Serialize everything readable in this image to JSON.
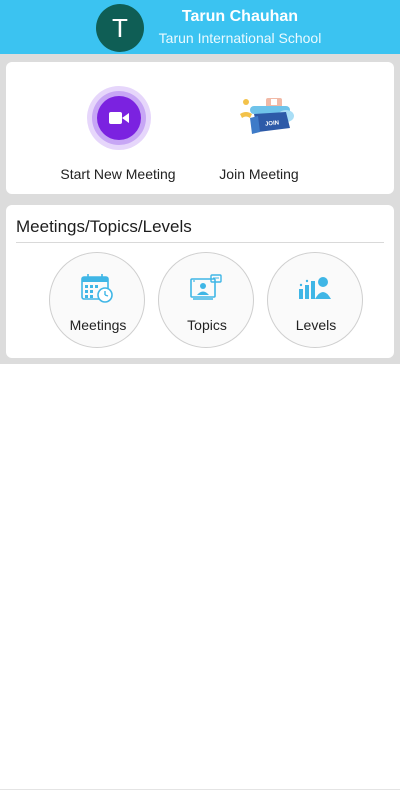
{
  "header": {
    "avatar_letter": "T",
    "user_name": "Tarun Chauhan",
    "school_name": "Tarun International School",
    "bg_color": "#3bc3f1"
  },
  "quick_actions": {
    "start_label": "Start New Meeting",
    "start_icon": "video-camera-icon",
    "join_label": "Join Meeting",
    "join_icon": "join-illustration-icon",
    "join_badge_text": "JOIN"
  },
  "section": {
    "title": "Meetings/Topics/Levels",
    "items": [
      {
        "label": "Meetings",
        "icon": "calendar-clock-icon"
      },
      {
        "label": "Topics",
        "icon": "presentation-board-icon"
      },
      {
        "label": "Levels",
        "icon": "bar-chart-user-icon"
      }
    ]
  }
}
